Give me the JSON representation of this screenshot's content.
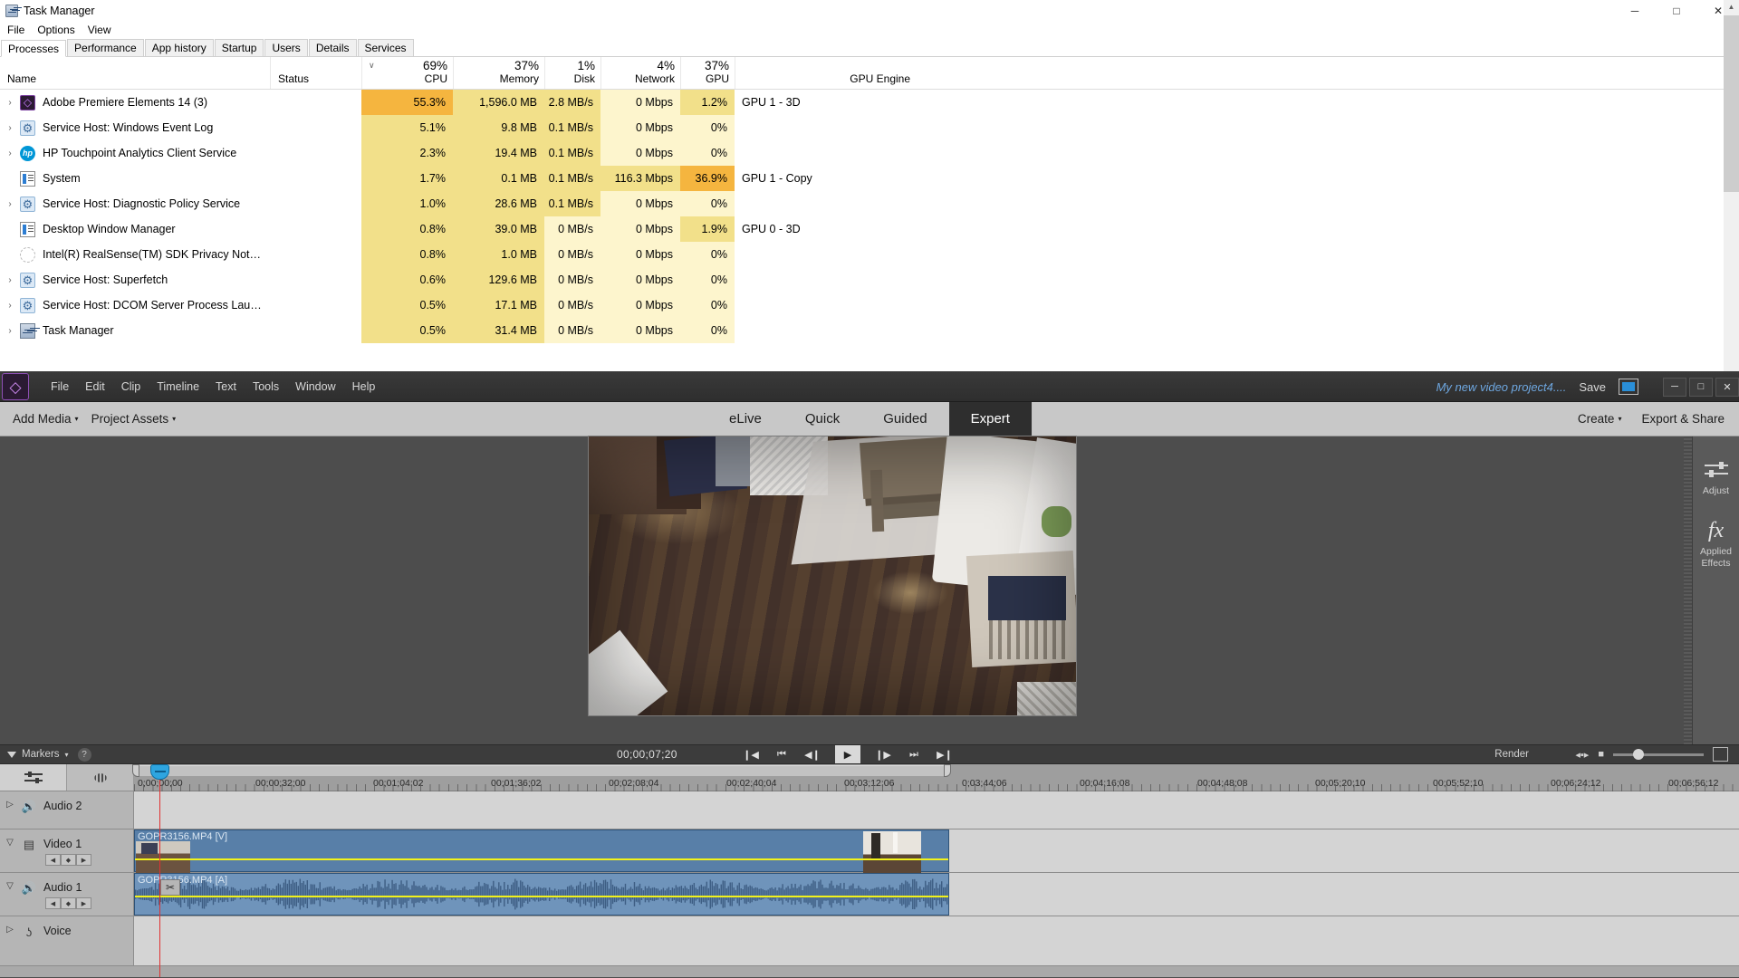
{
  "task_manager": {
    "window_title": "Task Manager",
    "menu": [
      "File",
      "Options",
      "View"
    ],
    "tabs": [
      {
        "label": "Processes",
        "active": true
      },
      {
        "label": "Performance",
        "active": false
      },
      {
        "label": "App history",
        "active": false
      },
      {
        "label": "Startup",
        "active": false
      },
      {
        "label": "Users",
        "active": false
      },
      {
        "label": "Details",
        "active": false
      },
      {
        "label": "Services",
        "active": false
      }
    ],
    "window_buttons": {
      "minimize": "─",
      "maximize": "□",
      "close": "✕"
    },
    "columns": [
      {
        "label": "Name",
        "pct": "",
        "sorted": false
      },
      {
        "label": "Status",
        "pct": "",
        "sorted": false
      },
      {
        "label": "CPU",
        "pct": "69%",
        "sorted": true
      },
      {
        "label": "Memory",
        "pct": "37%",
        "sorted": false
      },
      {
        "label": "Disk",
        "pct": "1%",
        "sorted": false
      },
      {
        "label": "Network",
        "pct": "4%",
        "sorted": false
      },
      {
        "label": "GPU",
        "pct": "37%",
        "sorted": false
      },
      {
        "label": "GPU Engine",
        "pct": "",
        "sorted": false
      }
    ],
    "rows": [
      {
        "name": "Adobe Premiere Elements 14 (3)",
        "icon": "premiere-icon",
        "expandable": true,
        "status": "",
        "cpu": "55.3%",
        "memory": "1,596.0 MB",
        "disk": "2.8 MB/s",
        "network": "0 Mbps",
        "gpu": "1.2%",
        "gpu_engine": "GPU 1 - 3D",
        "heat": {
          "cpu": 3,
          "memory": 2,
          "disk": 2,
          "network": 1,
          "gpu": 2
        }
      },
      {
        "name": "Service Host: Windows Event Log",
        "icon": "gear-icon",
        "expandable": true,
        "status": "",
        "cpu": "5.1%",
        "memory": "9.8 MB",
        "disk": "0.1 MB/s",
        "network": "0 Mbps",
        "gpu": "0%",
        "gpu_engine": "",
        "heat": {
          "cpu": 2,
          "memory": 2,
          "disk": 2,
          "network": 1,
          "gpu": 1
        }
      },
      {
        "name": "HP Touchpoint Analytics Client Service",
        "icon": "hp-icon",
        "expandable": true,
        "status": "",
        "cpu": "2.3%",
        "memory": "19.4 MB",
        "disk": "0.1 MB/s",
        "network": "0 Mbps",
        "gpu": "0%",
        "gpu_engine": "",
        "heat": {
          "cpu": 2,
          "memory": 2,
          "disk": 2,
          "network": 1,
          "gpu": 1
        }
      },
      {
        "name": "System",
        "icon": "system-icon",
        "expandable": false,
        "status": "",
        "cpu": "1.7%",
        "memory": "0.1 MB",
        "disk": "0.1 MB/s",
        "network": "116.3 Mbps",
        "gpu": "36.9%",
        "gpu_engine": "GPU 1 - Copy",
        "heat": {
          "cpu": 2,
          "memory": 2,
          "disk": 2,
          "network": 2,
          "gpu": 3
        }
      },
      {
        "name": "Service Host: Diagnostic Policy Service",
        "icon": "gear-icon",
        "expandable": true,
        "status": "",
        "cpu": "1.0%",
        "memory": "28.6 MB",
        "disk": "0.1 MB/s",
        "network": "0 Mbps",
        "gpu": "0%",
        "gpu_engine": "",
        "heat": {
          "cpu": 2,
          "memory": 2,
          "disk": 2,
          "network": 1,
          "gpu": 1
        }
      },
      {
        "name": "Desktop Window Manager",
        "icon": "system-icon",
        "expandable": false,
        "status": "",
        "cpu": "0.8%",
        "memory": "39.0 MB",
        "disk": "0 MB/s",
        "network": "0 Mbps",
        "gpu": "1.9%",
        "gpu_engine": "GPU 0 - 3D",
        "heat": {
          "cpu": 2,
          "memory": 2,
          "disk": 1,
          "network": 1,
          "gpu": 2
        }
      },
      {
        "name": "Intel(R) RealSense(TM) SDK Privacy Notifica...",
        "icon": "intel-icon",
        "expandable": false,
        "status": "",
        "cpu": "0.8%",
        "memory": "1.0 MB",
        "disk": "0 MB/s",
        "network": "0 Mbps",
        "gpu": "0%",
        "gpu_engine": "",
        "heat": {
          "cpu": 2,
          "memory": 2,
          "disk": 1,
          "network": 1,
          "gpu": 1
        }
      },
      {
        "name": "Service Host: Superfetch",
        "icon": "gear-icon",
        "expandable": true,
        "status": "",
        "cpu": "0.6%",
        "memory": "129.6 MB",
        "disk": "0 MB/s",
        "network": "0 Mbps",
        "gpu": "0%",
        "gpu_engine": "",
        "heat": {
          "cpu": 2,
          "memory": 2,
          "disk": 1,
          "network": 1,
          "gpu": 1
        }
      },
      {
        "name": "Service Host: DCOM Server Process Launch...",
        "icon": "gear-icon",
        "expandable": true,
        "status": "",
        "cpu": "0.5%",
        "memory": "17.1 MB",
        "disk": "0 MB/s",
        "network": "0 Mbps",
        "gpu": "0%",
        "gpu_engine": "",
        "heat": {
          "cpu": 2,
          "memory": 2,
          "disk": 1,
          "network": 1,
          "gpu": 1
        }
      },
      {
        "name": "Task Manager",
        "icon": "taskmgr-icon",
        "expandable": true,
        "status": "",
        "cpu": "0.5%",
        "memory": "31.4 MB",
        "disk": "0 MB/s",
        "network": "0 Mbps",
        "gpu": "0%",
        "gpu_engine": "",
        "heat": {
          "cpu": 2,
          "memory": 2,
          "disk": 1,
          "network": 1,
          "gpu": 1
        }
      }
    ]
  },
  "premiere": {
    "menu": [
      "File",
      "Edit",
      "Clip",
      "Timeline",
      "Text",
      "Tools",
      "Window",
      "Help"
    ],
    "project_name": "My new video project4....",
    "save_label": "Save",
    "window_buttons": {
      "minimize": "─",
      "maximize": "□",
      "close": "✕"
    },
    "toolbar_left": [
      {
        "label": "Add Media",
        "caret": "▾"
      },
      {
        "label": "Project Assets",
        "caret": "▾"
      }
    ],
    "modes": [
      {
        "label": "eLive",
        "active": false
      },
      {
        "label": "Quick",
        "active": false
      },
      {
        "label": "Guided",
        "active": false
      },
      {
        "label": "Expert",
        "active": true
      }
    ],
    "toolbar_right": [
      {
        "label": "Create",
        "caret": "▾"
      },
      {
        "label": "Export & Share",
        "caret": ""
      }
    ],
    "sidebar": [
      {
        "label": "Adjust",
        "icon": "sliders-icon"
      },
      {
        "label": "Applied Effects",
        "icon": "fx-icon"
      }
    ],
    "transport": {
      "markers_label": "Markers",
      "markers_caret": "▾",
      "help_label": "?",
      "timecode": "00;00;07;20",
      "buttons": [
        {
          "name": "set-in-point",
          "glyph": "❙◀"
        },
        {
          "name": "go-to-start",
          "glyph": "⏮"
        },
        {
          "name": "step-back",
          "glyph": "◀❙"
        },
        {
          "name": "play",
          "glyph": "▶"
        },
        {
          "name": "step-forward",
          "glyph": "❙▶"
        },
        {
          "name": "go-to-end",
          "glyph": "⏭"
        },
        {
          "name": "set-out-point",
          "glyph": "▶❙"
        }
      ],
      "render_label": "Render"
    },
    "timeline": {
      "ruler_ticks": [
        "0;00;00;00",
        "00;00;32;00",
        "00;01;04;02",
        "00;01;36;02",
        "00;02;08;04",
        "00;02;40;04",
        "00;03;12;06",
        "0;03;44;06",
        "00;04;16;08",
        "00;04;48;08",
        "00;05;20;10",
        "00;05;52;10",
        "00;06;24;12",
        "00;06;56;12"
      ],
      "tracks": [
        {
          "label": "Audio 2",
          "icon": "speaker-icon",
          "expanded": false,
          "has_keys": false,
          "clip": null
        },
        {
          "label": "Video 1",
          "icon": "film-icon",
          "expanded": true,
          "has_keys": true,
          "clip": {
            "label": "GOPR3156.MP4 [V]",
            "type": "video"
          }
        },
        {
          "label": "Audio 1",
          "icon": "speaker-icon",
          "expanded": true,
          "has_keys": true,
          "clip": {
            "label": "GOPR3156.MP4 [A]",
            "type": "audio"
          }
        },
        {
          "label": "Voice",
          "icon": "mic-icon",
          "expanded": false,
          "has_keys": false,
          "clip": null
        }
      ],
      "keyframe_buttons": [
        "◀",
        "◆",
        "▶"
      ]
    }
  },
  "colors": {
    "accent_blue": "#2a8fd8",
    "cti_red": "#e03232",
    "clip_video": "#587fa8",
    "clip_audio": "#6f94bb",
    "heat_high": "#f5b53f",
    "heat_mid": "#f2e08a",
    "heat_low": "#fdf5cd"
  }
}
